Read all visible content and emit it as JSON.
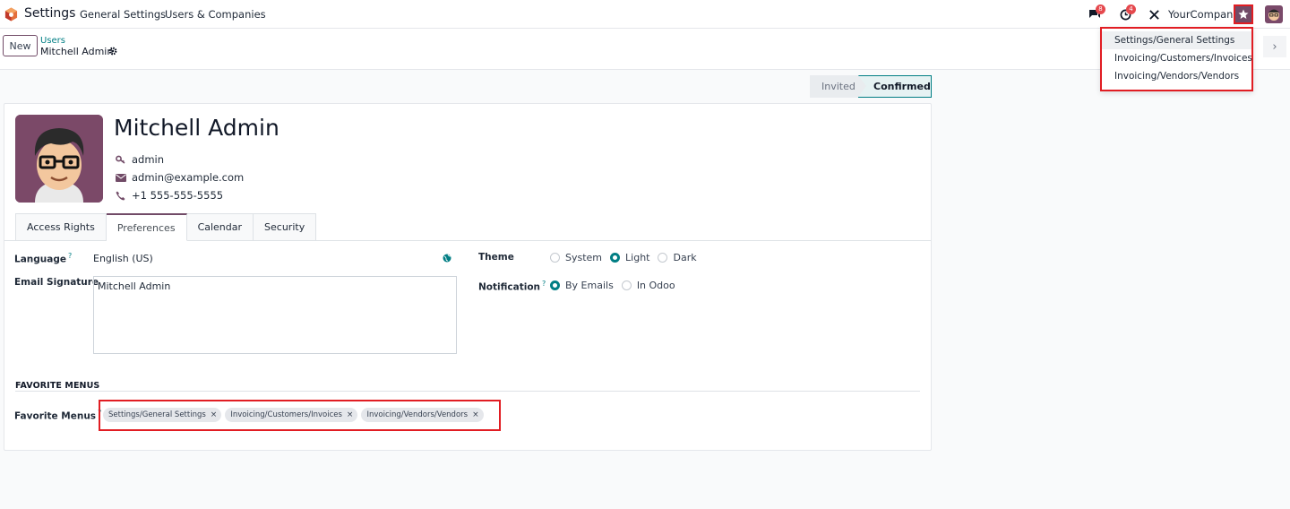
{
  "topnav": {
    "app_name": "Settings",
    "menus": [
      "General Settings",
      "Users & Companies"
    ],
    "messages_badge": "8",
    "activities_badge": "4",
    "company": "YourCompany",
    "icons": [
      "odoo-logo-icon",
      "chat-icon",
      "clock-icon",
      "tools-icon",
      "star-icon",
      "user-avatar"
    ]
  },
  "control": {
    "new_label": "New",
    "breadcrumb_parent": "Users",
    "breadcrumb_current": "Mitchell Admin",
    "pager_next": "›"
  },
  "status": {
    "stages": [
      "Invited",
      "Confirmed"
    ],
    "active": "Confirmed"
  },
  "user": {
    "name": "Mitchell Admin",
    "login": "admin",
    "email": "admin@example.com",
    "phone": "+1 555-555-5555"
  },
  "tabs": [
    "Access Rights",
    "Preferences",
    "Calendar",
    "Security"
  ],
  "active_tab": "Preferences",
  "preferences": {
    "language_label": "Language",
    "language_value": "English (US)",
    "signature_label": "Email Signature",
    "signature_value": "Mitchell Admin",
    "theme_label": "Theme",
    "theme_options": [
      "System",
      "Light",
      "Dark"
    ],
    "theme_selected": "Light",
    "notification_label": "Notification",
    "notification_options": [
      "By Emails",
      "In Odoo"
    ],
    "notification_selected": "By Emails",
    "help_mark": "?"
  },
  "favorites": {
    "section_title": "FAVORITE MENUS",
    "field_label": "Favorite Menus",
    "tags": [
      "Settings/General Settings",
      "Invoicing/Customers/Invoices",
      "Invoicing/Vendors/Vendors"
    ],
    "remove_glyph": "×"
  },
  "dropdown": {
    "items": [
      "Settings/General Settings",
      "Invoicing/Customers/Invoices",
      "Invoicing/Vendors/Vendors"
    ]
  },
  "colors": {
    "brand": "#714b67",
    "accent": "#017e84",
    "highlight_border": "#e11d23",
    "badge": "#e5484d"
  }
}
